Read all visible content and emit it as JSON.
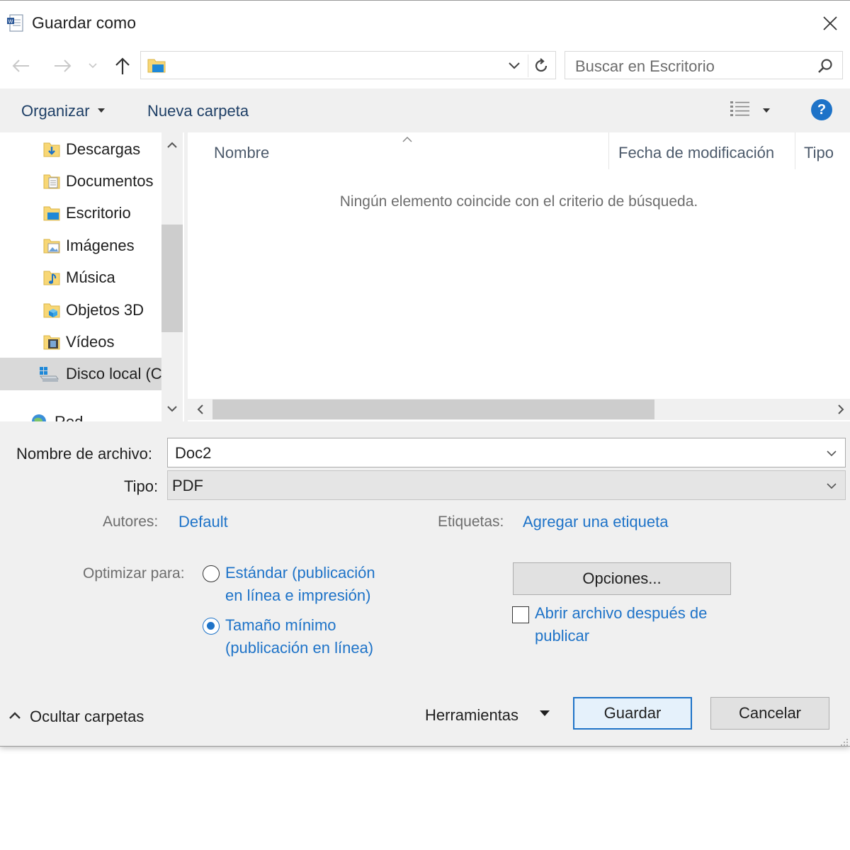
{
  "window": {
    "title": "Guardar como",
    "icon": "word-document-icon",
    "close_icon": "close-icon"
  },
  "navbar": {
    "back_icon": "arrow-left-icon",
    "forward_icon": "arrow-right-icon",
    "recent_icon": "chevron-down-icon",
    "up_icon": "arrow-up-icon",
    "address_folder_icon": "desktop-folder-icon",
    "refresh_icon": "refresh-icon",
    "search_placeholder": "Buscar en Escritorio"
  },
  "toolbar": {
    "organizar_label": "Organizar",
    "nueva_carpeta_label": "Nueva carpeta",
    "view_icon": "details-view-icon",
    "help_label": "?"
  },
  "sidebar": {
    "items": [
      {
        "label": "Descargas",
        "icon": "downloads-folder-icon"
      },
      {
        "label": "Documentos",
        "icon": "documents-folder-icon"
      },
      {
        "label": "Escritorio",
        "icon": "desktop-folder-icon"
      },
      {
        "label": "Imágenes",
        "icon": "pictures-folder-icon"
      },
      {
        "label": "Música",
        "icon": "music-folder-icon"
      },
      {
        "label": "Objetos 3D",
        "icon": "3d-objects-folder-icon"
      },
      {
        "label": "Vídeos",
        "icon": "videos-folder-icon"
      },
      {
        "label": "Disco local (C",
        "icon": "local-disk-icon",
        "selected": true
      },
      {
        "label": "Red",
        "icon": "network-icon"
      }
    ]
  },
  "filelist": {
    "columns": [
      "Nombre",
      "Fecha de modificación",
      "Tipo"
    ],
    "empty_message": "Ningún elemento coincide con el criterio de búsqueda."
  },
  "form": {
    "filename_label": "Nombre de archivo:",
    "filename_value": "Doc2",
    "type_label": "Tipo:",
    "type_value": "PDF",
    "authors_label": "Autores:",
    "authors_value": "Default",
    "tags_label": "Etiquetas:",
    "tags_value": "Agregar una etiqueta",
    "optimize_label": "Optimizar para:",
    "optimize_options": [
      {
        "line1": "Estándar (publicación",
        "line2": "en línea e impresión)",
        "checked": false
      },
      {
        "line1": "Tamaño mínimo",
        "line2": "(publicación en línea)",
        "checked": true
      }
    ],
    "options_button": "Opciones...",
    "open_after_line1": "Abrir archivo después de",
    "open_after_line2": "publicar",
    "open_after_checked": false
  },
  "footer": {
    "hide_folders_label": "Ocultar carpetas",
    "tools_label": "Herramientas",
    "save_label": "Guardar",
    "cancel_label": "Cancelar"
  },
  "colors": {
    "accent": "#1e73c8",
    "dialog_bg": "#f0f0f0",
    "link_text": "#1e73c8"
  }
}
